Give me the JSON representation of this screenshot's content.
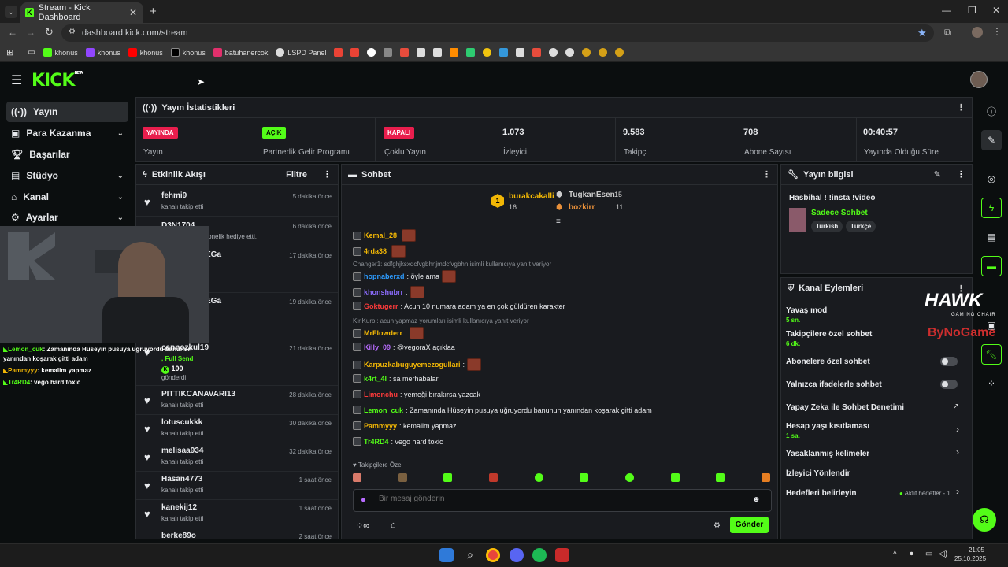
{
  "browser": {
    "tab_title": "Stream - Kick Dashboard",
    "url": "dashboard.kick.com/stream",
    "bookmarks": [
      "khonus",
      "khonus",
      "khonus",
      "khonus",
      "batuhanercok",
      "LSPD Panel"
    ]
  },
  "brand": {
    "logo": "KICK",
    "beta": "BETA"
  },
  "sidebar": {
    "items": [
      {
        "label": "Yayın",
        "icon": "broadcast-icon"
      },
      {
        "label": "Para Kazanma",
        "icon": "money-icon"
      },
      {
        "label": "Başarılar",
        "icon": "trophy-icon"
      },
      {
        "label": "Stüdyo",
        "icon": "studio-icon"
      },
      {
        "label": "Kanal",
        "icon": "channel-icon"
      },
      {
        "label": "Ayarlar",
        "icon": "gear-icon"
      }
    ]
  },
  "stats": {
    "title": "Yayın İstatistikleri",
    "cells": [
      {
        "badge": "YAYINDA",
        "label": "Yayın",
        "color": "#e91e4d"
      },
      {
        "badge": "AÇIK",
        "label": "Partnerlik Gelir Programı",
        "color": "#53fc18"
      },
      {
        "badge": "KAPALI",
        "label": "Çoklu Yayın",
        "color": "#e91e4d"
      },
      {
        "value": "1.073",
        "label": "İzleyici"
      },
      {
        "value": "9.583",
        "label": "Takipçi"
      },
      {
        "value": "708",
        "label": "Abone Sayısı"
      },
      {
        "value": "00:40:57",
        "label": "Yayında Olduğu Süre"
      }
    ]
  },
  "activity": {
    "title": "Etkinlik Akışı",
    "filter": "Filtre",
    "items": [
      {
        "name": "fehmi9",
        "sub": "kanalı takip etti",
        "time": "5 dakika önce"
      },
      {
        "name": "D3N1704",
        "sub": "nli kullanıcıya abonelik hediye etti.",
        "time": "6 dakika önce"
      },
      {
        "name": "EGa",
        "sub": "",
        "time": "17 dakika önce"
      },
      {
        "name": "EGa",
        "sub": "",
        "time": "19 dakika önce"
      },
      {
        "name": "cannozkul19",
        "sub": ", Full Send",
        "amount": "100",
        "amount_sub": "gönderdi",
        "time": "21 dakika önce"
      },
      {
        "name": "PITTIKCANAVARI13",
        "sub": "kanalı takip etti",
        "time": "28 dakika önce"
      },
      {
        "name": "lotuscukkk",
        "sub": "kanalı takip etti",
        "time": "30 dakika önce"
      },
      {
        "name": "melisaa934",
        "sub": "kanalı takip etti",
        "time": "32 dakika önce"
      },
      {
        "name": "Hasan4773",
        "sub": "kanalı takip etti",
        "time": "1 saat önce"
      },
      {
        "name": "kanekij12",
        "sub": "kanalı takip etti",
        "time": "1 saat önce"
      },
      {
        "name": "berke89o",
        "sub": "",
        "time": "2 saat önce"
      }
    ]
  },
  "chat": {
    "title": "Sohbet",
    "top": [
      {
        "name": "burakcakalli",
        "count": "16"
      },
      {
        "name": "TugkanEsen",
        "count": "15"
      },
      {
        "name": "bozkirr",
        "count": "11"
      }
    ],
    "messages": [
      {
        "user": "Kemal_28",
        "text": "",
        "color": "#f2b705",
        "emote": true
      },
      {
        "user": "4rda38",
        "text": "",
        "color": "#f2b705",
        "emote": true
      },
      {
        "reply": "Changer1: sdfghjksxdcfvgbhnjmdcfvgbhn isimli kullanıcıya yanıt veriyor"
      },
      {
        "user": "hopnaberxd",
        "text": ": öyle ama",
        "color": "#2d9cff",
        "emote": true
      },
      {
        "user": "khonshubrr",
        "text": ":",
        "color": "#8c6cff",
        "emote": true
      },
      {
        "user": "Goktugerr",
        "text": ": Acun 10 numara adam ya en çok güldüren karakter",
        "color": "#ff3b3b"
      },
      {
        "reply": "KiriKuroi: acun yapmaz yorumları isimli kullanıcıya yanıt veriyor"
      },
      {
        "user": "MrFlowderr",
        "text": ":",
        "color": "#f2b705",
        "emote": true
      },
      {
        "user": "Killy_09",
        "text": ": @vegoraX açıklaa",
        "color": "#b86cff"
      },
      {
        "user": "Karpuzkabuguyemezogullari",
        "text": ":",
        "color": "#f2b705",
        "emote": true
      },
      {
        "user": "k4rt_4l",
        "text": ": sa merhabalar",
        "color": "#53fc18"
      },
      {
        "user": "Limonchu",
        "text": ": yemeği bırakırsa yazcak",
        "color": "#ff3b3b"
      },
      {
        "user": "Lemon_cuk",
        "text": ": Zamanında Hüseyin pusuya uğruyordu banunun yanından koşarak gitti adam",
        "color": "#53fc18"
      },
      {
        "user": "Pammyyy",
        "text": ": kemalim yapmaz",
        "color": "#f2b705"
      },
      {
        "user": "Tr4RD4",
        "text": ": vego hard toxic",
        "color": "#53fc18"
      }
    ],
    "followers_only": "Takipçilere Özel",
    "placeholder": "Bir mesaj gönderin",
    "send": "Gönder"
  },
  "stream_info": {
    "title": "Yayın bilgisi",
    "stream_title": "Hasbihal ! !insta !video",
    "category": "Sadece Sohbet",
    "tags": [
      "Turkish",
      "Türkçe"
    ]
  },
  "channel_actions": {
    "title": "Kanal Eylemleri",
    "rows": [
      {
        "label": "Yavaş mod",
        "sub": "5 sn."
      },
      {
        "label": "Takipçilere özel sohbet",
        "sub": "6 dk."
      },
      {
        "label": "Abonelere özel sohbet",
        "toggle": false
      },
      {
        "label": "Yalnızca ifadelerle sohbet",
        "toggle": false
      },
      {
        "label": "Yapay Zeka ile Sohbet Denetimi"
      },
      {
        "label": "Hesap yaşı kısıtlaması",
        "sub": "1 sa."
      },
      {
        "label": "Yasaklanmış kelimeler"
      },
      {
        "label": "İzleyici Yönlendir"
      },
      {
        "label": "Hedefleri belirleyin",
        "extra": "Aktif hedefler - 1"
      }
    ]
  },
  "overlay": {
    "chat": [
      {
        "user": "Lemon_cuk",
        "text": ": Zamanında Hüseyin pusuya uğruyordu banunun yanından koşarak gitti adam"
      },
      {
        "user": "Pammyyy",
        "text": ": kemalim yapmaz"
      },
      {
        "user": "Tr4RD4",
        "text": ": vego hard toxic"
      }
    ],
    "sponsor1": "HAWK",
    "sponsor1_sub": "GAMING CHAIR",
    "sponsor2": "ByNoGame"
  },
  "taskbar": {
    "time": "21:05",
    "date": "25.10.2025"
  }
}
